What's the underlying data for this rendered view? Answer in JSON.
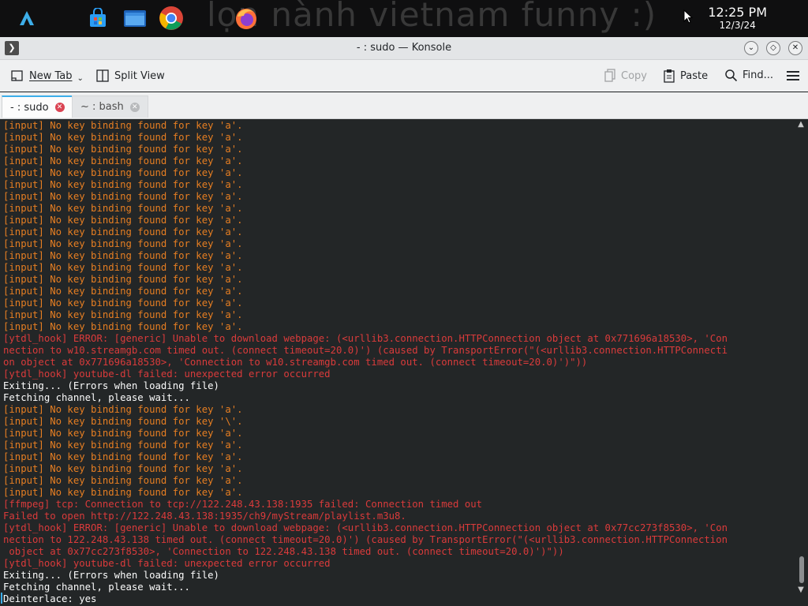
{
  "desktop": {
    "wallpaper_text": "lọn nành vietnam funny :)",
    "clock": {
      "time": "12:25 PM",
      "date": "12/3/24"
    },
    "launchers": [
      "app-launcher-icon",
      "store-icon",
      "file-manager-icon",
      "chrome-icon",
      "firefox-icon"
    ]
  },
  "window": {
    "title": "- : sudo — Konsole",
    "toolbar": {
      "new_tab": "New Tab",
      "split_view": "Split View",
      "copy": "Copy",
      "paste": "Paste",
      "find": "Find..."
    },
    "tabs": [
      {
        "label": "- : sudo",
        "active": true
      },
      {
        "label": "~ : bash",
        "active": false
      }
    ]
  },
  "terminal": {
    "lines": [
      {
        "t": "[input] No key binding found for key 'a'.",
        "c": "input"
      },
      {
        "t": "[input] No key binding found for key 'a'.",
        "c": "input"
      },
      {
        "t": "[input] No key binding found for key 'a'.",
        "c": "input"
      },
      {
        "t": "[input] No key binding found for key 'a'.",
        "c": "input"
      },
      {
        "t": "[input] No key binding found for key 'a'.",
        "c": "input"
      },
      {
        "t": "[input] No key binding found for key 'a'.",
        "c": "input"
      },
      {
        "t": "[input] No key binding found for key 'a'.",
        "c": "input"
      },
      {
        "t": "[input] No key binding found for key 'a'.",
        "c": "input"
      },
      {
        "t": "[input] No key binding found for key 'a'.",
        "c": "input"
      },
      {
        "t": "[input] No key binding found for key 'a'.",
        "c": "input"
      },
      {
        "t": "[input] No key binding found for key 'a'.",
        "c": "input"
      },
      {
        "t": "[input] No key binding found for key 'a'.",
        "c": "input"
      },
      {
        "t": "[input] No key binding found for key 'a'.",
        "c": "input"
      },
      {
        "t": "[input] No key binding found for key 'a'.",
        "c": "input"
      },
      {
        "t": "[input] No key binding found for key 'a'.",
        "c": "input"
      },
      {
        "t": "[input] No key binding found for key 'a'.",
        "c": "input"
      },
      {
        "t": "[input] No key binding found for key 'a'.",
        "c": "input"
      },
      {
        "t": "[input] No key binding found for key 'a'.",
        "c": "input"
      },
      {
        "t": "[ytdl_hook] ERROR: [generic] Unable to download webpage: (<urllib3.connection.HTTPConnection object at 0x771696a18530>, 'Con",
        "c": "err"
      },
      {
        "t": "nection to w10.streamgb.com timed out. (connect timeout=20.0)') (caused by TransportError(\"(<urllib3.connection.HTTPConnecti",
        "c": "err"
      },
      {
        "t": "on object at 0x771696a18530>, 'Connection to w10.streamgb.com timed out. (connect timeout=20.0)')\"))",
        "c": "err"
      },
      {
        "t": "[ytdl_hook] youtube-dl failed: unexpected error occurred",
        "c": "err"
      },
      {
        "t": "Exiting... (Errors when loading file)",
        "c": "norm"
      },
      {
        "t": "Fetching channel, please wait...",
        "c": "norm"
      },
      {
        "t": "[input] No key binding found for key 'a'.",
        "c": "input"
      },
      {
        "t": "[input] No key binding found for key '\\'.",
        "c": "input"
      },
      {
        "t": "[input] No key binding found for key 'a'.",
        "c": "input"
      },
      {
        "t": "[input] No key binding found for key 'a'.",
        "c": "input"
      },
      {
        "t": "[input] No key binding found for key 'a'.",
        "c": "input"
      },
      {
        "t": "[input] No key binding found for key 'a'.",
        "c": "input"
      },
      {
        "t": "[input] No key binding found for key 'a'.",
        "c": "input"
      },
      {
        "t": "[input] No key binding found for key 'a'.",
        "c": "input"
      },
      {
        "t": "[ffmpeg] tcp: Connection to tcp://122.248.43.138:1935 failed: Connection timed out",
        "c": "err"
      },
      {
        "t": "Failed to open http://122.248.43.138:1935/ch9/myStream/playlist.m3u8.",
        "c": "err"
      },
      {
        "t": "[ytdl_hook] ERROR: [generic] Unable to download webpage: (<urllib3.connection.HTTPConnection object at 0x77cc273f8530>, 'Con",
        "c": "err"
      },
      {
        "t": "nection to 122.248.43.138 timed out. (connect timeout=20.0)') (caused by TransportError(\"(<urllib3.connection.HTTPConnection",
        "c": "err"
      },
      {
        "t": " object at 0x77cc273f8530>, 'Connection to 122.248.43.138 timed out. (connect timeout=20.0)')\"))",
        "c": "err"
      },
      {
        "t": "[ytdl_hook] youtube-dl failed: unexpected error occurred",
        "c": "err"
      },
      {
        "t": "Exiting... (Errors when loading file)",
        "c": "norm"
      },
      {
        "t": "Fetching channel, please wait...",
        "c": "norm"
      },
      {
        "t": "Deinterlace: yes",
        "c": "norm"
      }
    ]
  },
  "colors": {
    "accent": "#3daee9",
    "input_text": "#e67e22",
    "error_text": "#da3b3b",
    "normal_text": "#fcfcfc",
    "terminal_bg": "#232627"
  }
}
